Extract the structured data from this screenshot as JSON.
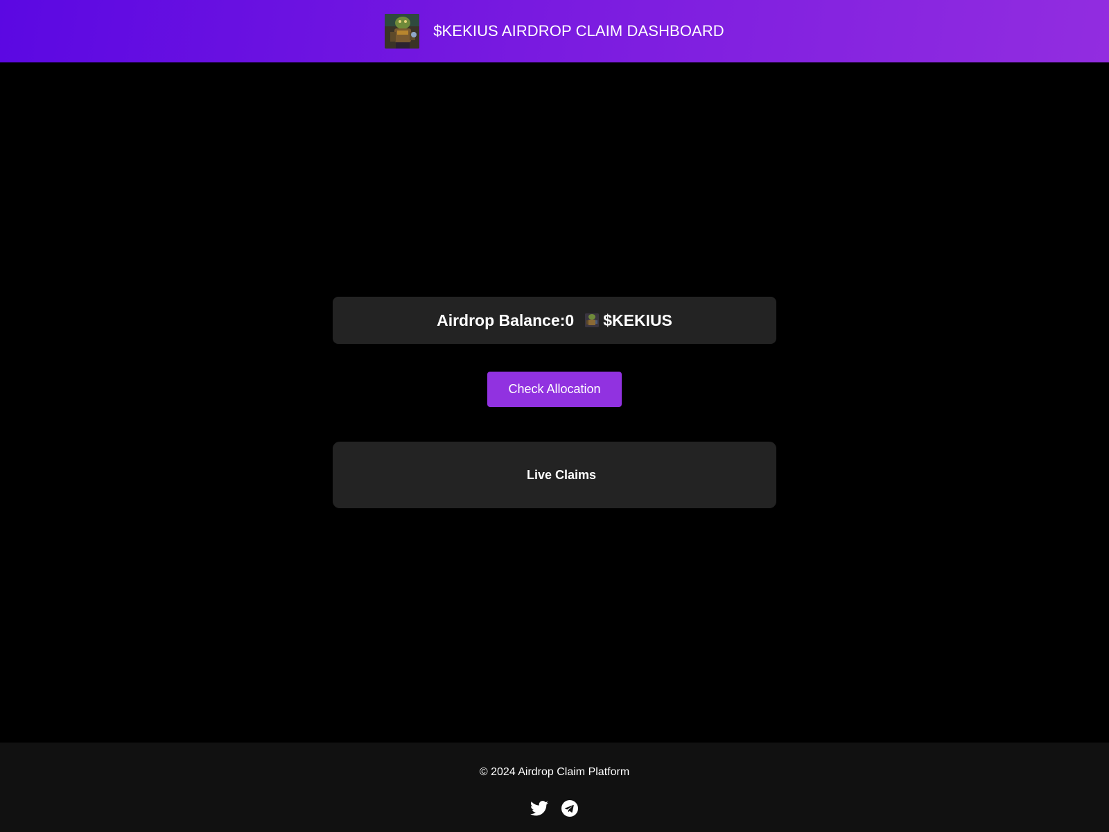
{
  "header": {
    "title": "$KEKIUS AIRDROP CLAIM DASHBOARD",
    "logo_icon": "kekius-avatar-icon"
  },
  "balance": {
    "label": "Airdrop Balance:",
    "value": "0",
    "token_icon": "kekius-token-icon",
    "token": "$KEKIUS"
  },
  "actions": {
    "check_allocation_label": "Check Allocation"
  },
  "live_claims": {
    "title": "Live Claims"
  },
  "footer": {
    "copyright": "© 2024 Airdrop Claim Platform",
    "social": [
      "twitter-icon",
      "telegram-icon"
    ]
  },
  "colors": {
    "header_gradient_start": "#5b08e2",
    "header_gradient_end": "#922de0",
    "button": "#9132e0",
    "card": "#232323",
    "footer": "#111111",
    "background": "#000000"
  }
}
